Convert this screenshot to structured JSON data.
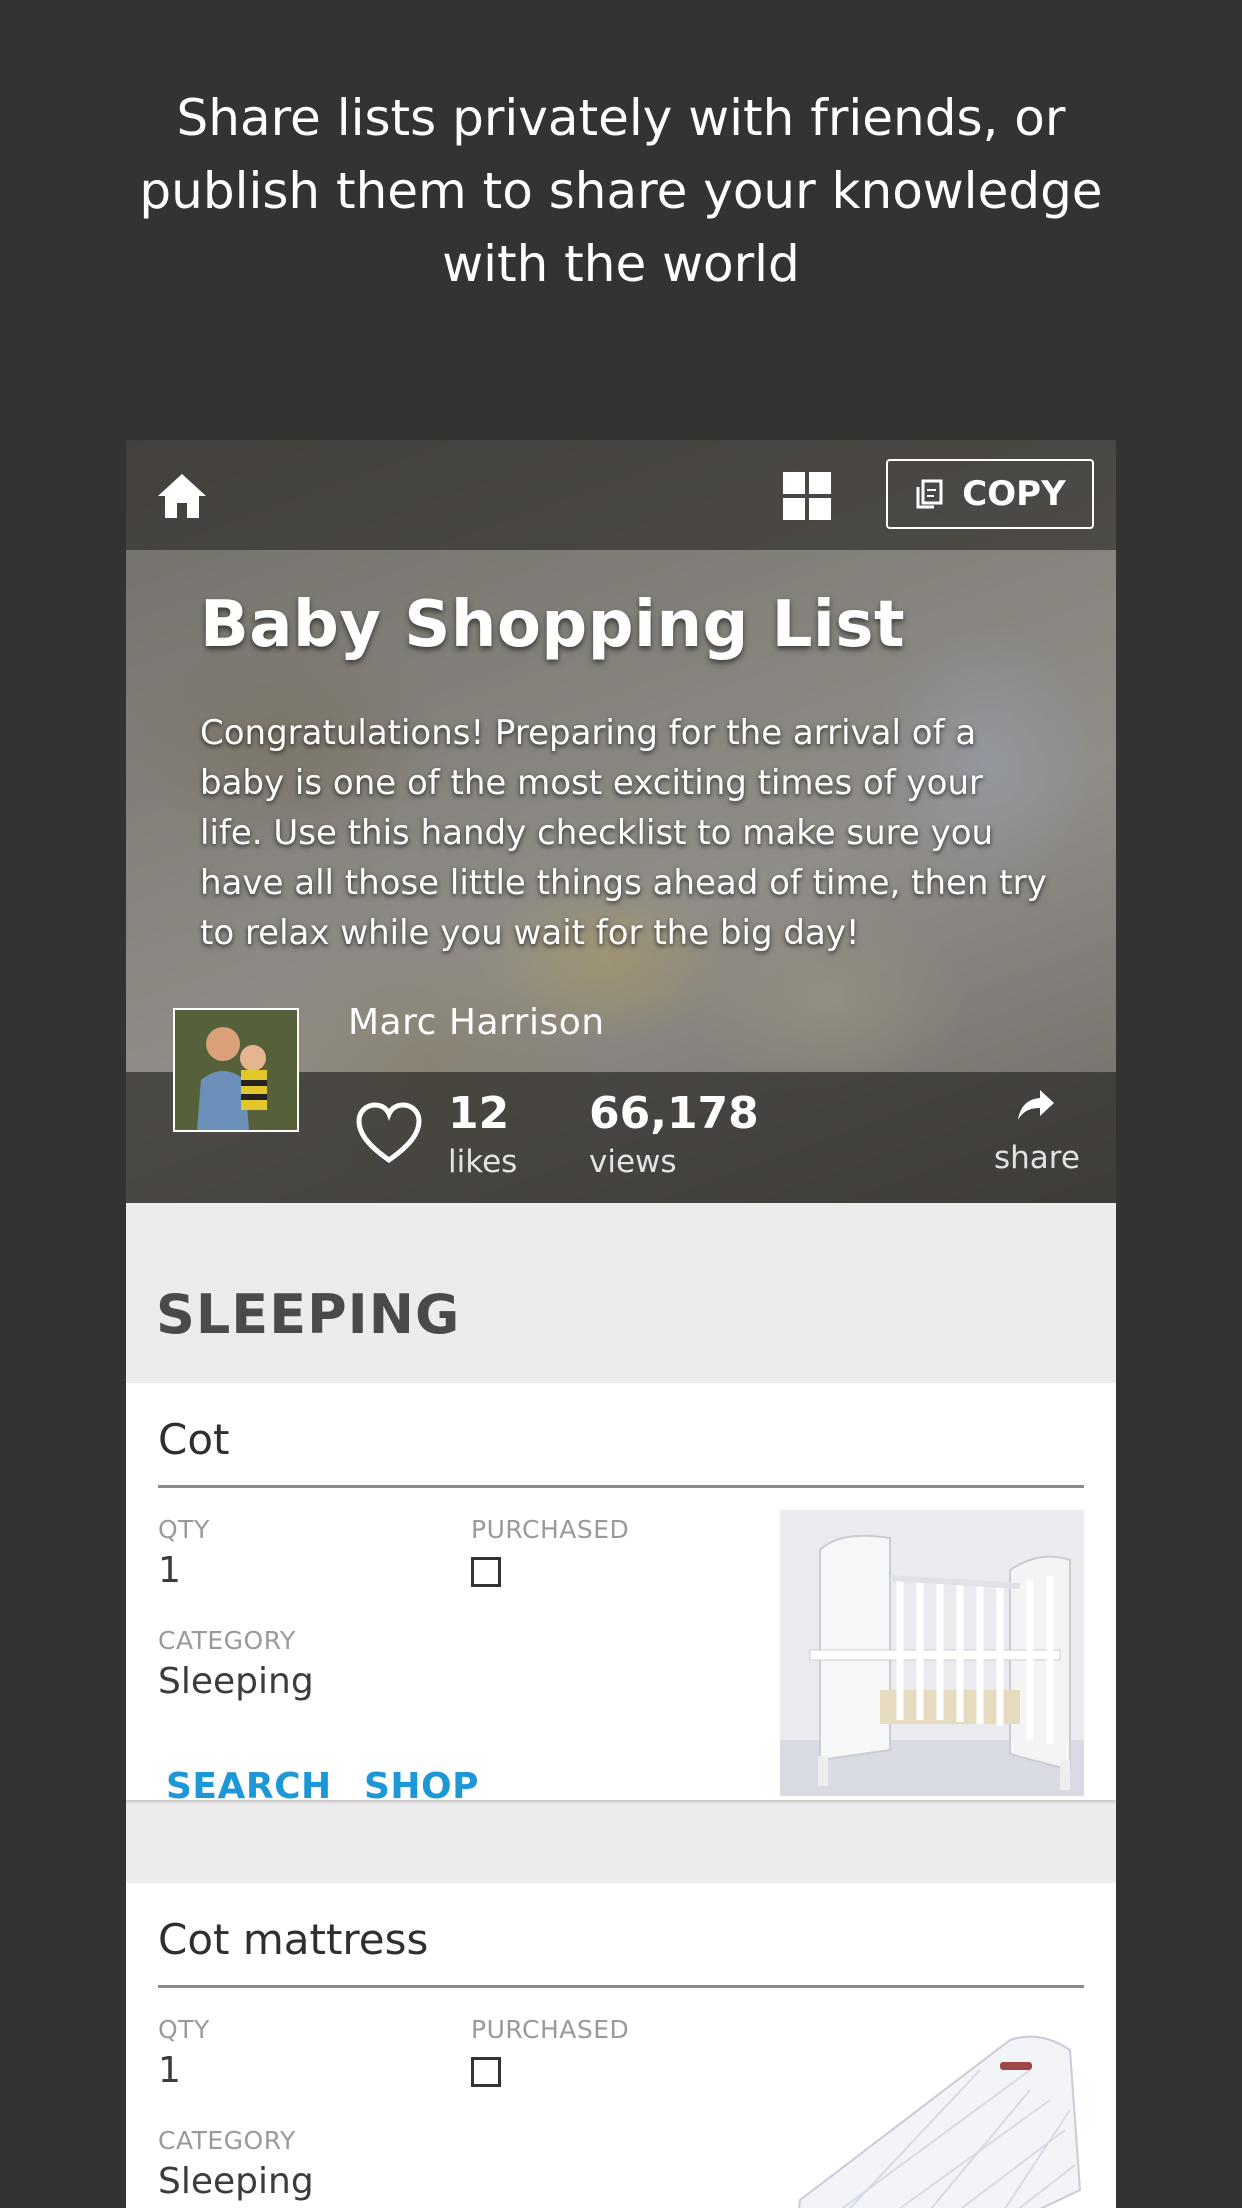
{
  "promo": {
    "line1": "Share lists privately with friends, or",
    "line2": "publish them to share your knowledge",
    "line3": "with the world"
  },
  "toolbar": {
    "copy_label": "COPY"
  },
  "list": {
    "title": "Baby Shopping List",
    "description": "Congratulations! Preparing for the arrival of a baby is one of the most exciting times of your life. Use this handy checklist to make sure you have all those little things ahead of time, then try to relax while you wait for the big day!",
    "author": "Marc Harrison",
    "likes_count": "12",
    "likes_label": "likes",
    "views_count": "66,178",
    "views_label": "views",
    "share_label": "share"
  },
  "section": {
    "title": "SLEEPING"
  },
  "items": [
    {
      "name": "Cot",
      "qty_label": "QTY",
      "qty": "1",
      "purchased_label": "PURCHASED",
      "purchased": false,
      "category_label": "CATEGORY",
      "category": "Sleeping",
      "search_label": "SEARCH",
      "shop_label": "SHOP"
    },
    {
      "name": "Cot mattress",
      "qty_label": "QTY",
      "qty": "1",
      "purchased_label": "PURCHASED",
      "purchased": false,
      "category_label": "CATEGORY",
      "category": "Sleeping"
    }
  ],
  "colors": {
    "background": "#353331",
    "accent_link": "#1e97d6",
    "list_background": "#ececec"
  }
}
